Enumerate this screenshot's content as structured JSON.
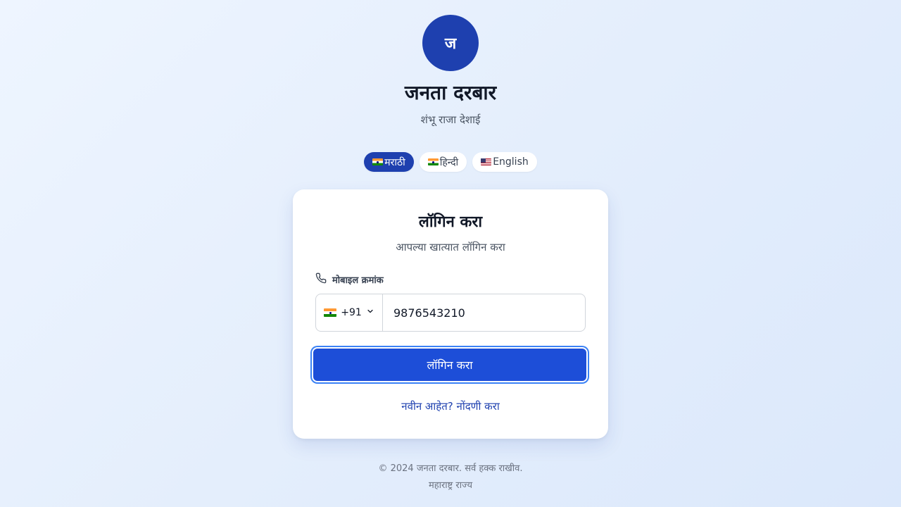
{
  "brand": {
    "logo_letter": "ज",
    "title": "जनता दरबार",
    "subtitle": "शंभू राजा देशाई"
  },
  "languages": [
    {
      "label": "मराठी",
      "flag": "india-flag-icon",
      "active": true
    },
    {
      "label": "हिन्दी",
      "flag": "india-flag-icon",
      "active": false
    },
    {
      "label": "English",
      "flag": "us-flag-icon",
      "active": false
    }
  ],
  "login": {
    "title": "लॉगिन करा",
    "subtitle": "आपल्या खात्यात लॉगिन करा",
    "mobile_label": "मोबाइल क्रमांक",
    "country_code": "+91",
    "mobile_value": "9876543210",
    "submit_label": "लॉगिन करा",
    "register_link": "नवीन आहेत? नोंदणी करा"
  },
  "footer": {
    "copyright": "© 2024 जनता दरबार. सर्व हक्क राखीव.",
    "state": "महाराष्ट्र राज्य"
  },
  "colors": {
    "primary": "#1e40af",
    "button": "#1d4ed8"
  }
}
